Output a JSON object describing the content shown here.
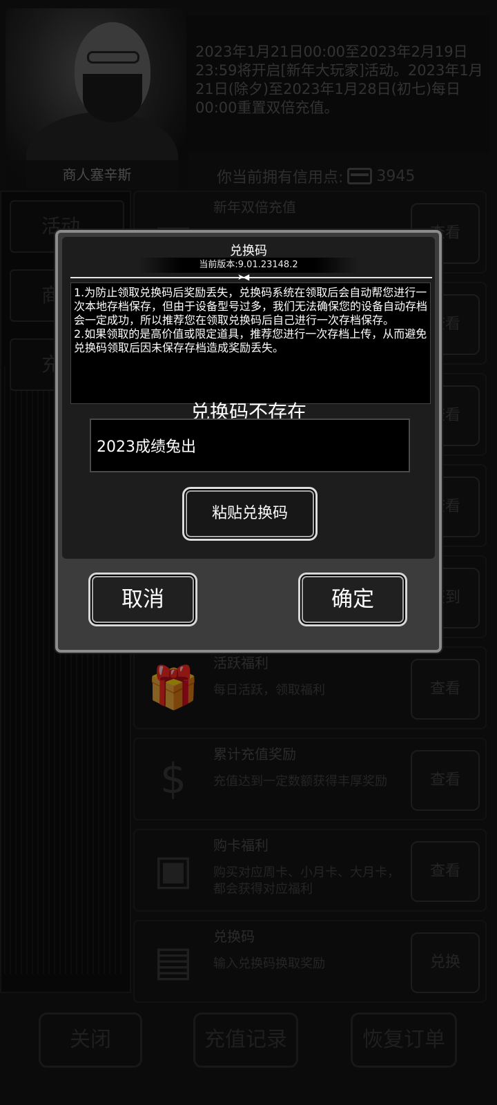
{
  "merchant": {
    "name": "商人塞辛斯"
  },
  "info": {
    "text": "2023年1月21日00:00至2023年2月19日23:59将开启[新年大玩家]活动。2023年1月21日(除夕)至2023年1月28日(初七)每日00:00重置双倍充值。"
  },
  "credits": {
    "label": "你当前拥有信用点:",
    "icon": "card-icon",
    "value": "3945"
  },
  "left_tabs": [
    "活动",
    "商",
    "充"
  ],
  "items": [
    {
      "title": "新年双倍充值",
      "desc": "",
      "button": "查看",
      "icon": "card-icon"
    },
    {
      "title": "",
      "desc": "",
      "button": "查看",
      "icon": ""
    },
    {
      "title": "",
      "desc": "",
      "button": "查看",
      "icon": ""
    },
    {
      "title": "",
      "desc": "",
      "button": "查看",
      "icon": ""
    },
    {
      "title": "",
      "desc": "",
      "button": "签到",
      "icon": ""
    },
    {
      "title": "活跃福利",
      "desc": "每日活跃，领取福利",
      "button": "查看",
      "icon": "gift-icon"
    },
    {
      "title": "累计充值奖励",
      "desc": "充值达到一定数额获得丰厚奖励",
      "button": "查看",
      "icon": "money-bag-icon"
    },
    {
      "title": "购卡福利",
      "desc": "购买对应周卡、小月卡、大月卡，都会获得对应福利",
      "button": "查看",
      "icon": "trophy-card-icon"
    },
    {
      "title": "兑换码",
      "desc": "输入兑换码换取奖励",
      "button": "兑换",
      "icon": "scroll-icon"
    }
  ],
  "item_buttons_partial": [
    "查看",
    "查看",
    "查看",
    "查看",
    "到"
  ],
  "bottom": {
    "close": "关闭",
    "records": "充值记录",
    "restore": "恢复订单"
  },
  "dialog": {
    "title": "兑换码",
    "version": "当前版本:9.01.23148.2",
    "notice": "1.为防止领取兑换码后奖励丢失，兑换码系统在领取后会自动帮您进行一次本地存档保存，但由于设备型号过多，我们无法确保您的设备自动存档会一定成功，所以推荐您在领取兑换码后自己进行一次存档保存。\n2.如果领取的是高价值或限定道具，推荐您进行一次存档上传，从而避免兑换码领取后因未保存存档造成奖励丢失。",
    "status": "兑换码不存在",
    "input_value": "2023成绩兔出",
    "paste_label": "粘贴兑换码",
    "cancel_label": "取消",
    "confirm_label": "确定"
  }
}
